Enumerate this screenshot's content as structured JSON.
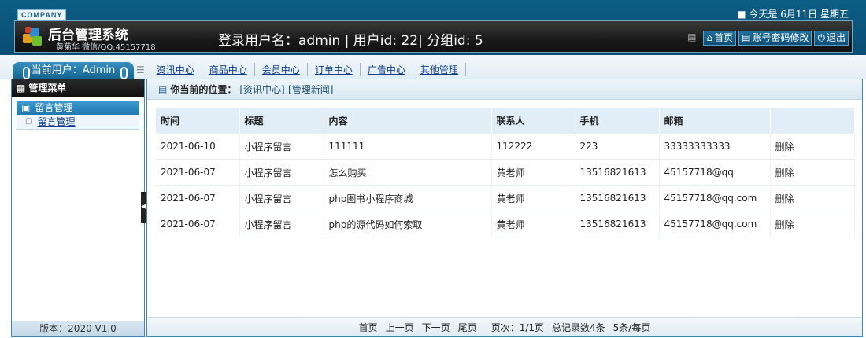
{
  "header": {
    "company": "COMPANY",
    "date_text": "今天是 6月11日 星期五",
    "system_name": "后台管理系统",
    "contact": "黄菊华 微信/QQ:45157718",
    "user_line": "登录用户名：admin | 用户id: 22| 分组id: 5",
    "buttons": {
      "home": "首页",
      "password": "账号密码修改",
      "logout": "退出"
    }
  },
  "nav": {
    "current_user": "当前用户：Admin",
    "links": [
      "资讯中心",
      "商品中心",
      "会员中心",
      "订单中心",
      "广告中心",
      "其他管理"
    ]
  },
  "sidebar": {
    "menu_title": "管理菜单",
    "section": "留言管理",
    "item": "留言管理",
    "version": "版本：2020 V1.0"
  },
  "main": {
    "location_label": "你当前的位置：",
    "location_path": "[资讯中心]-[管理新闻]",
    "columns": [
      "时间",
      "标题",
      "内容",
      "联系人",
      "手机",
      "邮箱",
      ""
    ],
    "rows": [
      [
        "2021-06-10",
        "小程序留言",
        "111111",
        "112222",
        "223",
        "33333333333",
        "删除"
      ],
      [
        "2021-06-07",
        "小程序留言",
        "怎么购买",
        "黄老师",
        "13516821613",
        "45157718@qq",
        "删除"
      ],
      [
        "2021-06-07",
        "小程序留言",
        "php图书小程序商城",
        "黄老师",
        "13516821613",
        "45157718@qq.com",
        "删除"
      ],
      [
        "2021-06-07",
        "小程序留言",
        "php的源代码如何索取",
        "黄老师",
        "13516821613",
        "45157718@qq.com",
        "删除"
      ]
    ],
    "pager": {
      "first": "首页",
      "prev": "上一页",
      "next": "下一页",
      "last": "尾页",
      "page_info": "页次：1/1页",
      "total": "总记录数4条",
      "per_page": "5条/每页"
    }
  }
}
